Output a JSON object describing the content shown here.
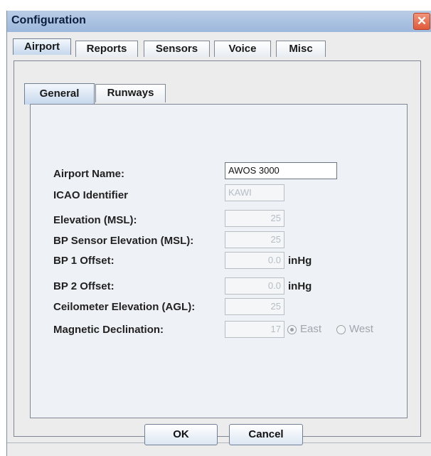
{
  "window": {
    "title": "Configuration",
    "close_glyph": "✕"
  },
  "main_tabs": [
    "Airport",
    "Reports",
    "Sensors",
    "Voice",
    "Misc"
  ],
  "sub_tabs": [
    "General",
    "Runways"
  ],
  "form": {
    "airport_name": {
      "label": "Airport Name:",
      "value": "AWOS 3000"
    },
    "icao": {
      "label": "ICAO Identifier",
      "value": "KAWI"
    },
    "elevation": {
      "label": "Elevation (MSL):",
      "value": "25"
    },
    "bp_sensor_elevation": {
      "label": "BP Sensor Elevation (MSL):",
      "value": "25"
    },
    "bp1_offset": {
      "label": "BP 1 Offset:",
      "value": "0.0",
      "unit": "inHg"
    },
    "bp2_offset": {
      "label": "BP 2 Offset:",
      "value": "0.0",
      "unit": "inHg"
    },
    "ceilometer_elevation": {
      "label": "Ceilometer Elevation (AGL):",
      "value": "25"
    },
    "magnetic_declination": {
      "label": "Magnetic Declination:",
      "value": "17",
      "east_label": "East",
      "west_label": "West",
      "selected": "East"
    }
  },
  "buttons": {
    "ok": "OK",
    "cancel": "Cancel"
  },
  "colors": {
    "title_bar": "#b9cde6",
    "close_button": "#e05a3a",
    "active_tab": "#c5d7ec",
    "panel_background": "#ececec"
  }
}
